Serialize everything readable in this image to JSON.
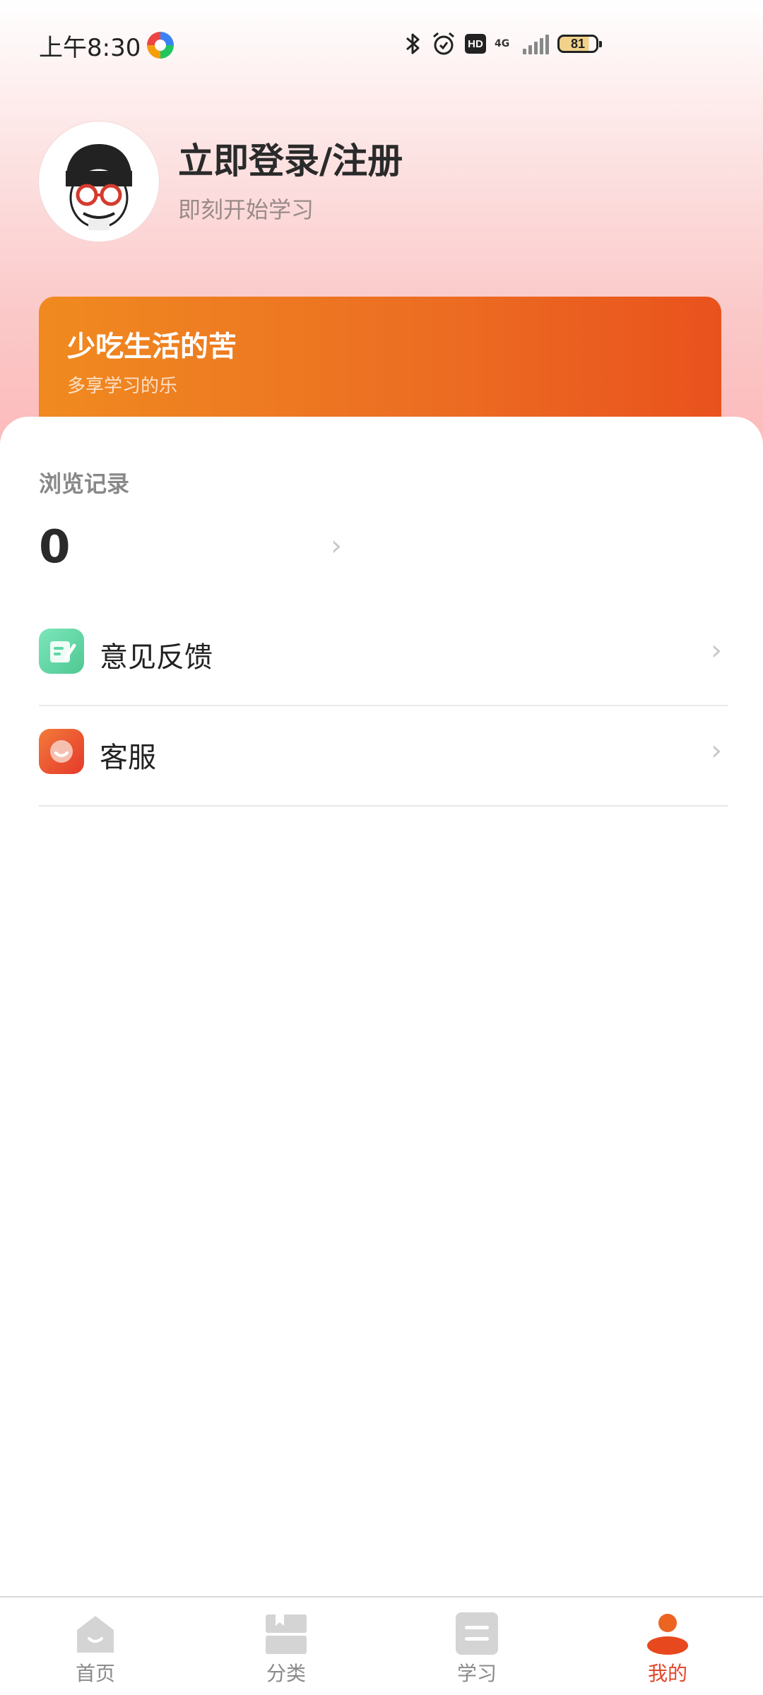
{
  "status_bar": {
    "time": "上午8:30",
    "network": "4G",
    "battery": "81"
  },
  "profile": {
    "login_title": "立即登录/注册",
    "login_subtitle": "即刻开始学习"
  },
  "banner": {
    "title": "少吃生活的苦",
    "subtitle": "多享学习的乐"
  },
  "history": {
    "label": "浏览记录",
    "count": "0"
  },
  "menu": {
    "items": [
      {
        "label": "意见反馈",
        "icon": "feedback-icon",
        "color": "#5dd6a6"
      },
      {
        "label": "客服",
        "icon": "customer-service-icon",
        "color": "#ec5a2e"
      }
    ]
  },
  "tab_bar": {
    "tabs": [
      {
        "label": "首页",
        "icon": "home-icon",
        "active": false
      },
      {
        "label": "分类",
        "icon": "category-icon",
        "active": false
      },
      {
        "label": "学习",
        "icon": "study-icon",
        "active": false
      },
      {
        "label": "我的",
        "icon": "profile-icon",
        "active": true
      }
    ],
    "active_color": "#e2472a",
    "inactive_color": "#8a8a8a"
  },
  "colors": {
    "banner_start": "#f08a20",
    "banner_end": "#e9521d"
  }
}
